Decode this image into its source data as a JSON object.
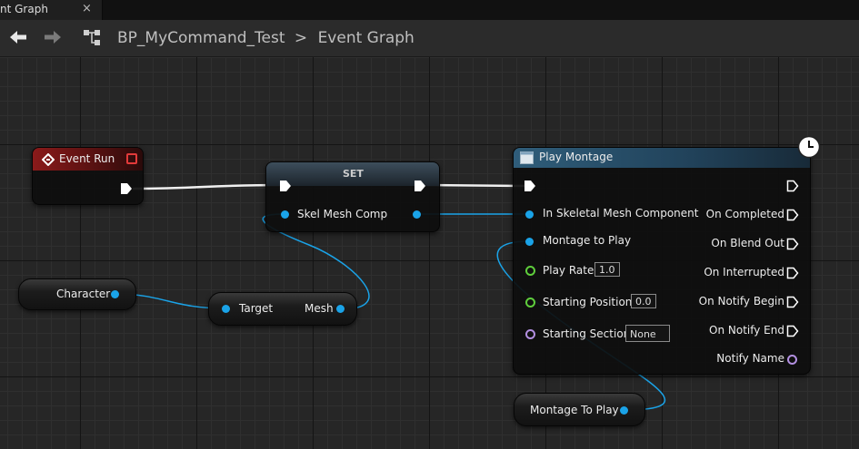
{
  "tab": {
    "label": "nt Graph",
    "close": "×"
  },
  "breadcrumb": {
    "blueprint": "BP_MyCommand_Test",
    "separator": ">",
    "graph": "Event Graph"
  },
  "nodes": {
    "event_run": {
      "title": "Event Run"
    },
    "set": {
      "title": "SET",
      "input": "Skel Mesh Comp"
    },
    "character": {
      "label": "Character"
    },
    "get_mesh": {
      "input": "Target",
      "output": "Mesh"
    },
    "play_montage": {
      "title": "Play Montage",
      "inputs": [
        "In Skeletal Mesh Component",
        "Montage to Play",
        "Play Rate",
        "Starting Position",
        "Starting Section"
      ],
      "defaults": {
        "play_rate": "1.0",
        "starting_position": "0.0",
        "starting_section": "None"
      },
      "outputs": [
        "On Completed",
        "On Blend Out",
        "On Interrupted",
        "On Notify Begin",
        "On Notify End",
        "Notify Name"
      ]
    },
    "montage_var": {
      "label": "Montage To Play"
    }
  },
  "colors": {
    "exec": "#ffffff",
    "object_pin": "#1aa3e8",
    "float_pin": "#5fce3c",
    "name_pin": "#b28fe0",
    "event_header": "#8b1a1a",
    "function_header": "#2f5d7a"
  }
}
